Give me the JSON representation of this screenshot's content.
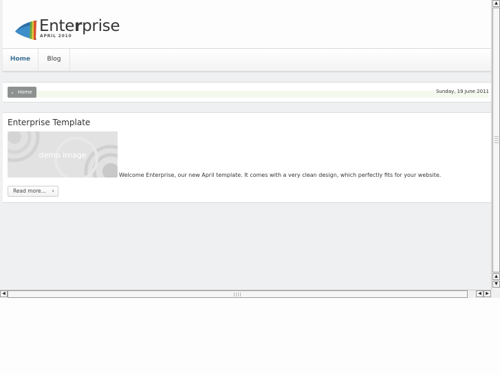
{
  "header": {
    "logo_word_light": "Ente",
    "logo_word_bold": "r",
    "logo_word_rest": "prise",
    "logo_tagline": "APRIL 2010"
  },
  "nav": {
    "items": [
      {
        "label": "Home",
        "active": true
      },
      {
        "label": "Blog",
        "active": false
      }
    ]
  },
  "breadcrumb": {
    "home_label": "Home",
    "date": "Sunday, 19 June 2011"
  },
  "article": {
    "title": "Enterprise Template",
    "image_label": "demo image",
    "intro": "Welcome Enterprise, our new April template. It comes with a very clean design, which perfectly fits for your website.",
    "read_more": "Read more..."
  },
  "icons": {
    "breadcrumb_chevron": "chevron-down-icon",
    "read_more_arrow": "chevron-right-icon",
    "scroll_up": "arrow-up-icon",
    "scroll_down": "arrow-down-icon",
    "scroll_left": "arrow-left-icon",
    "scroll_right": "arrow-right-icon"
  },
  "colors": {
    "page_background": "#eff0f1",
    "nav_active": "#3a6f95",
    "breadcrumb_button": "#8d9190"
  }
}
